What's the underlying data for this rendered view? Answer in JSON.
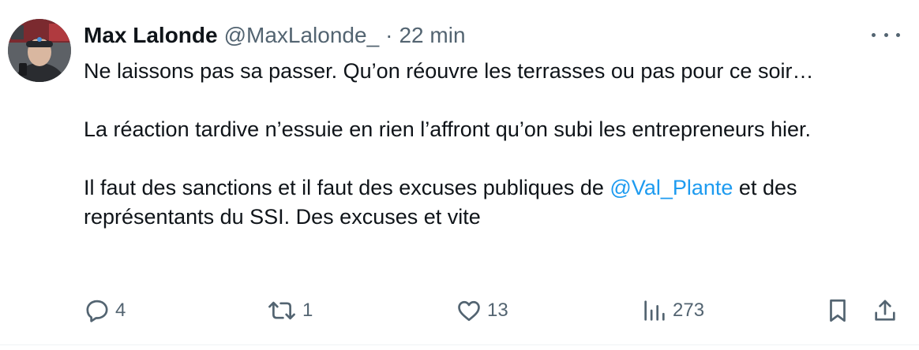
{
  "tweet": {
    "author": {
      "name": "Max Lalonde",
      "handle": "@MaxLalonde_"
    },
    "separator": "·",
    "time": "22 min",
    "paragraphs": [
      "Ne laissons pas sa passer. Qu’on réouvre les terrasses ou pas pour ce soir…",
      "La réaction tardive n’essuie en rien l’affront qu’on subi les entrepreneurs hier.",
      {
        "before": "Il faut des sanctions et il faut des excuses publiques de ",
        "mention": "@Val_Plante",
        "after": " et des représentants du SSI. Des excuses et vite"
      }
    ],
    "stats": {
      "replies": "4",
      "reposts": "1",
      "likes": "13",
      "views": "273"
    }
  },
  "icons": {
    "more": "more-horizontal-icon",
    "reply": "reply-icon",
    "repost": "repost-icon",
    "like": "heart-icon",
    "views": "views-chart-icon",
    "bookmark": "bookmark-icon",
    "share": "share-icon"
  },
  "colors": {
    "text": "#0f1419",
    "muted": "#536471",
    "mention": "#1d9bf0",
    "divider": "#eff3f4"
  }
}
